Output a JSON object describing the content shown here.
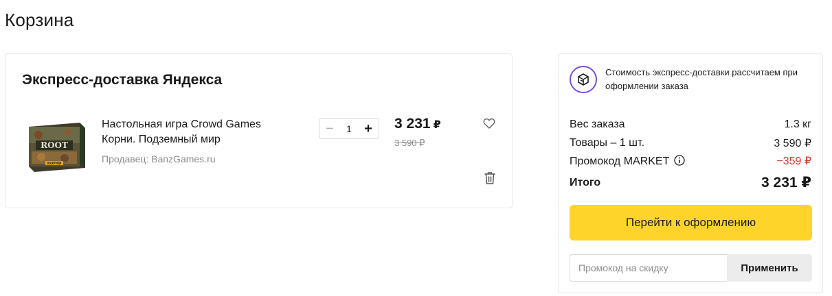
{
  "page": {
    "title": "Корзина"
  },
  "cart": {
    "delivery_title": "Экспресс-доставка Яндекса",
    "item": {
      "name": "Настольная игра Crowd Games Корни. Подземный мир",
      "seller": "Продавец: BanzGames.ru",
      "quantity": "1",
      "qty_minus": "−",
      "qty_plus": "+",
      "price": "3 231",
      "currency": "₽",
      "old_price": "3 590 ₽",
      "image_title": "ROOT",
      "image_subtitle": "КОРНИ",
      "icons": {
        "favorite": "heart-icon",
        "delete": "trash-icon"
      }
    }
  },
  "summary": {
    "delivery_note": "Стоимость экспресс-доставки рассчитаем при оформлении заказа",
    "weight_label": "Вес заказа",
    "weight_value": "1.3 кг",
    "goods_label": "Товары – 1 шт.",
    "goods_value": "3 590 ₽",
    "promo_label": "Промокод MARKET",
    "promo_value": "−359 ₽",
    "total_label": "Итого",
    "total_value": "3 231 ₽",
    "checkout_label": "Перейти к оформлению",
    "promo_placeholder": "Промокод на скидку",
    "apply_label": "Применить"
  },
  "colors": {
    "accent_yellow": "#fed42b",
    "discount_red": "#e0312b",
    "badge_purple": "#7b4cdd"
  }
}
